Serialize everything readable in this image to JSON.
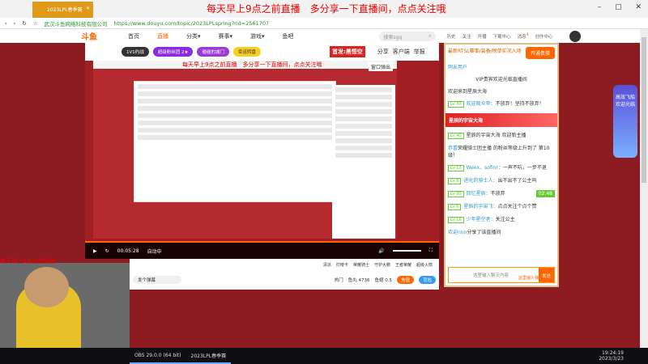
{
  "browser": {
    "tab_title": "2023LPL春季赛",
    "overlay_text": "每天早上9点之前直播　多分享一下直播间，点点关注哦",
    "org": "武汉斗鱼网络科技有限公司",
    "url": "https://www.douyu.com/topic/2023LPLspring?rid=2561707"
  },
  "header": {
    "logo": "斗鱼",
    "nav": [
      "首页",
      "直播",
      "分类▾",
      "赛事▾",
      "游戏▾",
      "鱼吧"
    ],
    "search_placeholder": "搜索sgq",
    "icons": [
      "历史",
      "关注",
      "开播",
      "下载中心",
      "消息",
      "创作中心"
    ],
    "msg_count": "4"
  },
  "video": {
    "pills": [
      "1V1约战",
      "超级粉丝团 2★",
      "碰碰的城门",
      "幸运转盘"
    ],
    "top_badge": "首发:黑悟空",
    "actions": [
      "分享",
      "客户端",
      "举报"
    ],
    "popout": "窗口弹出",
    "time": "00:05:28",
    "quality": "自动中"
  },
  "giftbar": {
    "gifts": [
      "清凉",
      "打榜卡",
      "荣耀骑士",
      "守护大鹏",
      "王者荣耀",
      "超级火箭"
    ],
    "danmu_placeholder": "发个弹幕",
    "hot": "热门",
    "balance": "鱼丸 4736",
    "fish": "鱼翅 0.5",
    "recharge": "充值",
    "backpack": "背包"
  },
  "chat": {
    "top_text": "最新RTSL赛事/装备/榜单实况入场",
    "top_btn": "开通贵族",
    "messages": [
      {
        "lv": "",
        "name": "网友用户",
        "text": ""
      },
      {
        "lv": "",
        "name": "",
        "text": "VIP贵宾欢迎光临直播间"
      },
      {
        "lv": "",
        "name": "",
        "text": "欢迎来到星辰大海"
      },
      {
        "lv": "LV 30",
        "name": "欢迎观众甲：",
        "text": "不放弃！坚持不放弃！"
      },
      {
        "lv": "LV 40",
        "name": "",
        "text": "星辰的宇宙大海 欢迎新主播"
      },
      {
        "lv": "",
        "name": "恭喜",
        "text": "荣耀骑士团主播 的粉丝等级上升到了 第10级！"
      },
      {
        "lv": "LV 12",
        "name": "Weex、sofinr：",
        "text": "一声不吭，一步不退"
      },
      {
        "lv": "LV 8",
        "name": "进化的骑士人：",
        "text": "出不出不了公主吗"
      },
      {
        "lv": "LV 30",
        "name": "回忆星辰：",
        "text": "不放弃"
      },
      {
        "lv": "LV 6",
        "name": "星辰的宇宙飞：",
        "text": "点点关注个点个赞"
      },
      {
        "lv": "LV 16",
        "name": "少年星空者：",
        "text": "关注公主"
      },
      {
        "lv": "",
        "name": "欢迎nnn",
        "text": "分享了该直播间"
      }
    ],
    "banner": "星辰的宇宙大海",
    "chest_timer": "02:48",
    "input_placeholder": "这里输入聊天内容",
    "input_hint": "这里输入弹幕",
    "send": "发送"
  },
  "cam": {
    "label": "每天早上9点之前直播"
  },
  "taskbar": {
    "apps": [
      "OBS 29.0.0 (64 bit)",
      "2023LPL春季赛"
    ],
    "time": "19:24:19",
    "date": "2023/3/23"
  },
  "side_badge": {
    "text": "高效飞船 欢迎光临"
  }
}
